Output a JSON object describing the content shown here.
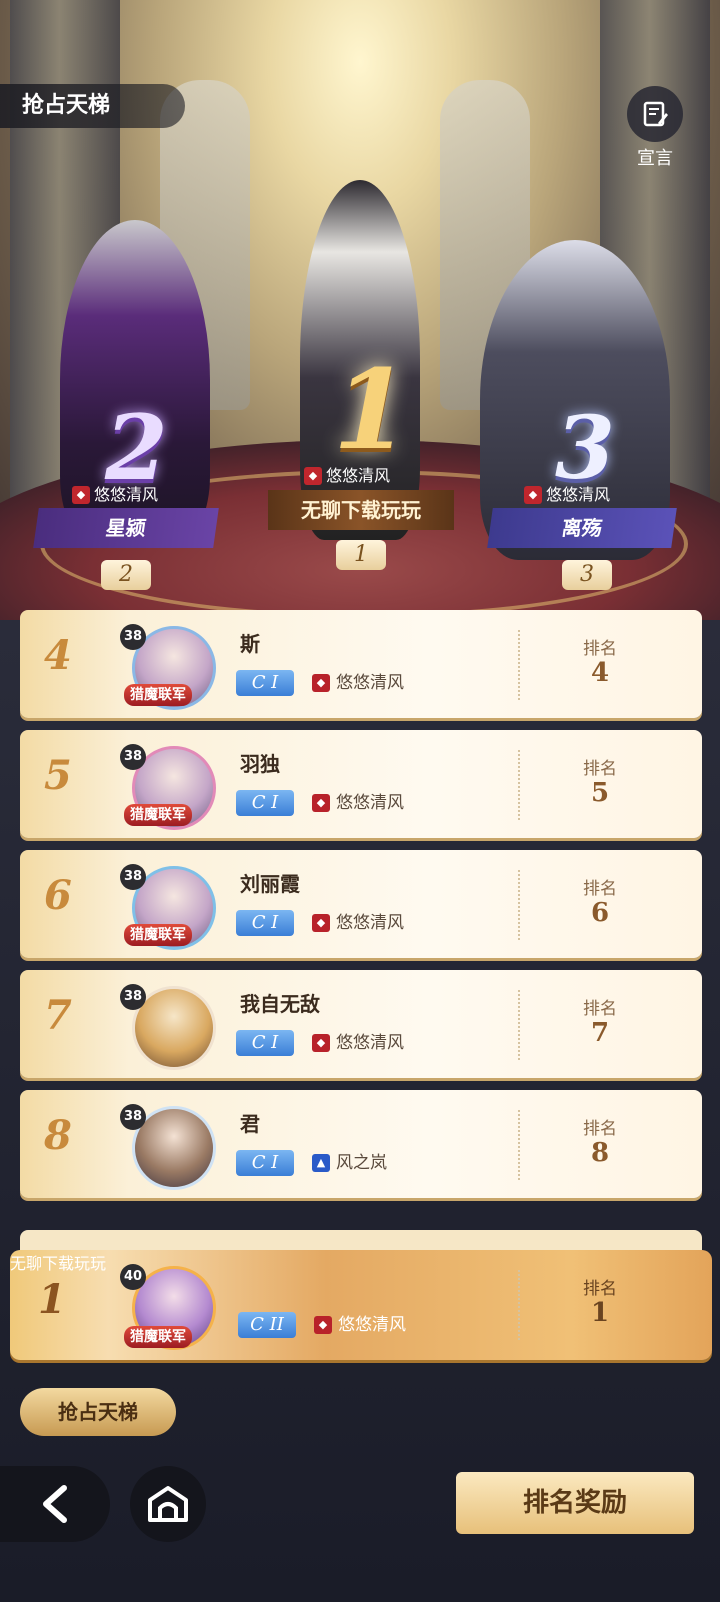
{
  "header": {
    "title": "抢占天梯",
    "declare_label": "宣言"
  },
  "podium": [
    {
      "rank_number": "1",
      "guild": "悠悠清风",
      "name": "无聊下载玩玩",
      "pedestal": "1"
    },
    {
      "rank_number": "2",
      "guild": "悠悠清风",
      "name": "星颍",
      "pedestal": "2"
    },
    {
      "rank_number": "3",
      "guild": "悠悠清风",
      "name": "离殇",
      "pedestal": "3"
    }
  ],
  "rank_label": "排名",
  "list": [
    {
      "rank": "4",
      "level": "38",
      "name": "斯",
      "tier": "C I",
      "guild": "悠悠清风",
      "rank_value": "4",
      "legion": "猎魔联军"
    },
    {
      "rank": "5",
      "level": "38",
      "name": "羽独",
      "tier": "C I",
      "guild": "悠悠清风",
      "rank_value": "5",
      "legion": "猎魔联军"
    },
    {
      "rank": "6",
      "level": "38",
      "name": "刘丽霞",
      "tier": "C I",
      "guild": "悠悠清风",
      "rank_value": "6",
      "legion": "猎魔联军"
    },
    {
      "rank": "7",
      "level": "38",
      "name": "我自无敌",
      "tier": "C I",
      "guild": "悠悠清风",
      "rank_value": "7",
      "legion": ""
    },
    {
      "rank": "8",
      "level": "38",
      "name": "君",
      "tier": "C I",
      "guild": "风之岚",
      "rank_value": "8",
      "legion": ""
    }
  ],
  "self": {
    "rank": "1",
    "level": "40",
    "name": "无聊下载玩玩",
    "tier": "C II",
    "guild": "悠悠清风",
    "rank_value": "1",
    "legion": "猎魔联军"
  },
  "buttons": {
    "ladder": "抢占天梯",
    "reward": "排名奖励"
  },
  "icons": {
    "declare": "note-pen-icon",
    "back": "back-arrow-icon",
    "home": "home-icon",
    "guild": "guild-emblem-icon"
  }
}
